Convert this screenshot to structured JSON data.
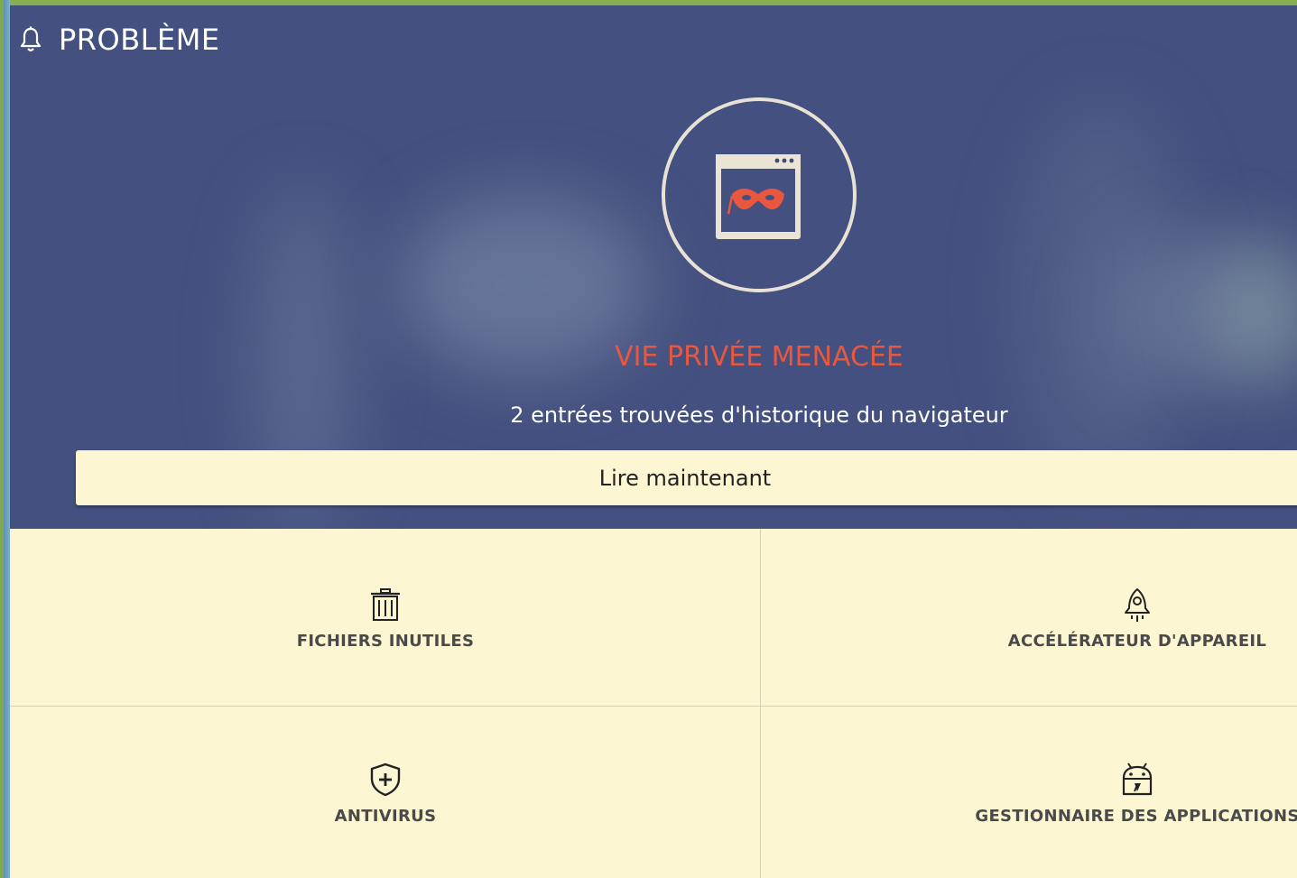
{
  "header": {
    "title": "PROBLÈME",
    "icon": "bell-icon"
  },
  "threat": {
    "icon": "browser-mask-icon",
    "title": "VIE PRIVÉE MENACÉE",
    "subtitle": "2 entrées trouvées d'historique du navigateur",
    "action_label": "Lire maintenant"
  },
  "tiles": [
    {
      "label": "FICHIERS INUTILES",
      "icon": "trash-icon"
    },
    {
      "label": "ACCÉLÉRATEUR D'APPAREIL",
      "icon": "rocket-icon"
    },
    {
      "label": "ANTIVIRUS",
      "icon": "shield-plus-icon"
    },
    {
      "label": "GESTIONNAIRE DES APPLICATIONS",
      "icon": "app-manager-icon"
    }
  ],
  "colors": {
    "hero_background": "#44507f",
    "threat_title": "#e9573f",
    "tile_background": "#fdf6d3",
    "frame": "#7fa84f"
  }
}
